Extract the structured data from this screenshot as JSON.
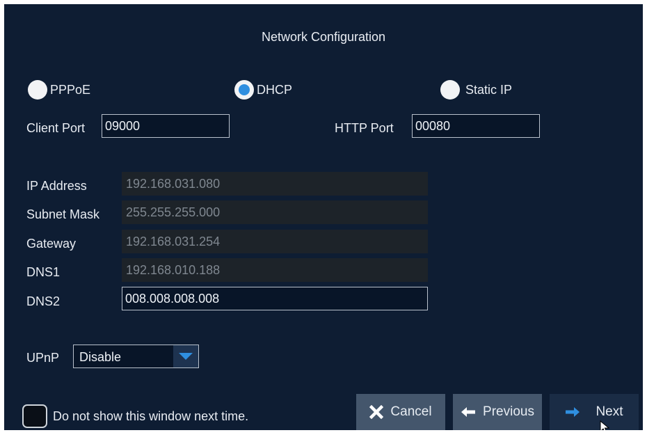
{
  "dialog": {
    "title": "Network Configuration"
  },
  "mode": {
    "options": [
      {
        "label": "PPPoE",
        "checked": false
      },
      {
        "label": "DHCP",
        "checked": true
      },
      {
        "label": "Static IP",
        "checked": false
      }
    ]
  },
  "ports": {
    "client_port_label": "Client Port",
    "client_port_value": "09000",
    "http_port_label": "HTTP Port",
    "http_port_value": "00080"
  },
  "network": {
    "ip_label": "IP Address",
    "ip_value": "192.168.031.080",
    "subnet_label": "Subnet Mask",
    "subnet_value": "255.255.255.000",
    "gateway_label": "Gateway",
    "gateway_value": "192.168.031.254",
    "dns1_label": "DNS1",
    "dns1_value": "192.168.010.188",
    "dns2_label": "DNS2",
    "dns2_value": "008.008.008.008"
  },
  "upnp": {
    "label": "UPnP",
    "value": "Disable"
  },
  "footer": {
    "checkbox_label": "Do not show this window next time.",
    "cancel_label": "Cancel",
    "previous_label": "Previous",
    "next_label": "Next"
  },
  "colors": {
    "background": "#0e1d33",
    "accent": "#2f8fe0",
    "button": "#44566c",
    "disabled_field": "#1d2329"
  },
  "icons": {
    "cancel": "x-icon",
    "previous": "arrow-left-icon",
    "next": "arrow-right-icon",
    "dropdown": "caret-down-icon"
  }
}
